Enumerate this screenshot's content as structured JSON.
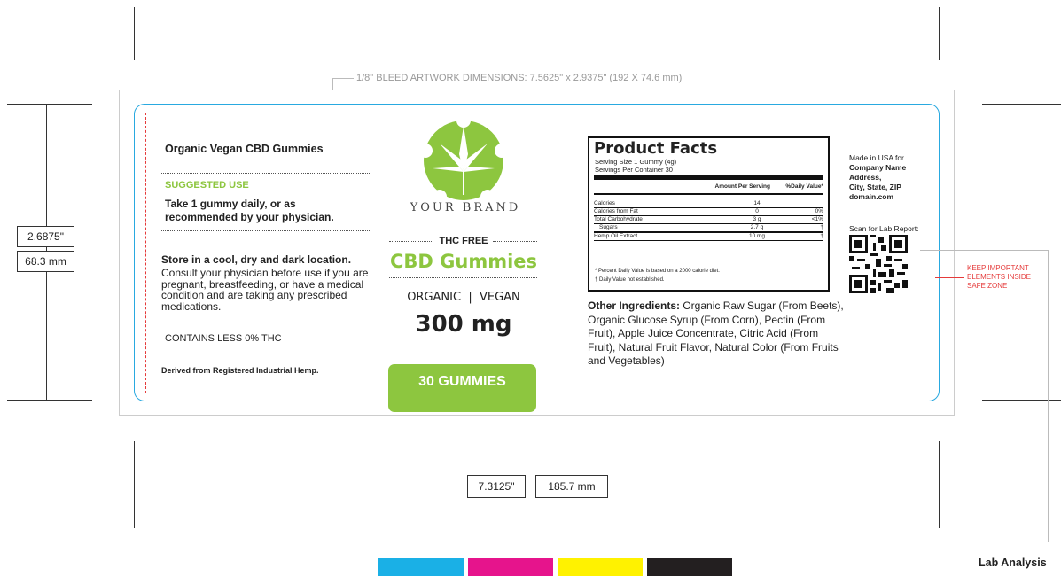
{
  "dimensions": {
    "bleed_label": "1/8\" BLEED ARTWORK DIMENSIONS:  7.5625\" x 2.9375\" (192 X 74.6 mm)",
    "height_in": "2.6875\"",
    "height_mm": "68.3 mm",
    "width_in": "7.3125\"",
    "width_mm": "185.7 mm"
  },
  "left": {
    "title": "Organic Vegan CBD Gummies",
    "suggested_heading": "SUGGESTED USE",
    "suggested_text": "Take 1 gummy daily, or as recommended by your physician.",
    "storage_heading": "Store in a cool, dry and dark location.",
    "storage_text": "Consult your physician before use if you are pregnant, breastfeeding, or have a medical condition and are taking any prescribed medications.",
    "thc_note": "CONTAINS LESS 0% THC",
    "derived": "Derived from Registered Industrial Hemp."
  },
  "center": {
    "brand": "YOUR BRAND",
    "thc_free": "THC FREE",
    "product": "CBD Gummies",
    "attributes": "ORGANIC  |  VEGAN",
    "strength": "300 mg",
    "count": "30 GUMMIES",
    "accent_color": "#8dc63f"
  },
  "facts": {
    "title": "Product Facts",
    "serving_size": "Serving Size 1 Gummy (4g)",
    "servings_per": "Servings Per Container 30",
    "col_amount": "Amount Per Serving",
    "col_dv": "%Daily Value*",
    "rows": [
      {
        "name": "Calories",
        "amount": "14",
        "dv": ""
      },
      {
        "name": "Calories from Fat",
        "amount": "0",
        "dv": "0%"
      },
      {
        "name": "Total Carbohydrate",
        "amount": "3 g",
        "dv": "<1%"
      },
      {
        "name": "Sugars",
        "amount": "2.7 g",
        "dv": "†"
      },
      {
        "name": "Hemp Oil Extract",
        "amount": "10 mg",
        "dv": "†"
      }
    ],
    "footnote1": "* Percent Daily Value is based on a 2000 calorie diet.",
    "footnote2": "† Daily Value not established."
  },
  "ingredients": {
    "label": "Other Ingredients:",
    "text": " Organic Raw Sugar (From Beets), Organic Glucose Syrup (From Corn), Pectin (From Fruit), Apple Juice Concentrate, Citric Acid (From Fruit), Natural Fruit Flavor, Natural Color (From Fruits and Vegetables)"
  },
  "company": {
    "made_in": "Made in USA for",
    "name": "Company Name",
    "address": "Address,",
    "city": "City, State, ZIP",
    "domain": "domain.com",
    "scan": "Scan for Lab Report:",
    "qr_icon": "qr-code-icon"
  },
  "annotations": {
    "safe_zone": "KEEP IMPORTANT ELEMENTS INSIDE SAFE ZONE",
    "lab": "Lab Analysis",
    "safe_color": "#e53a3a"
  },
  "swatches": [
    "#1ab0e6",
    "#e6148c",
    "#fff200",
    "#231f20"
  ]
}
